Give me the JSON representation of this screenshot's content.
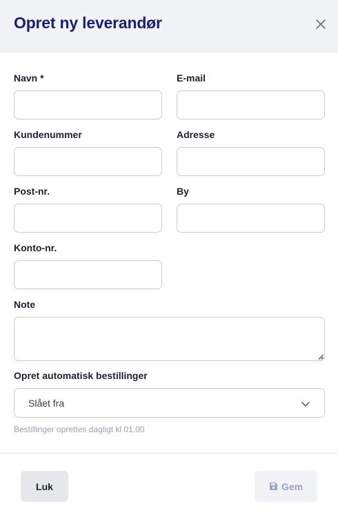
{
  "header": {
    "title": "Opret ny leverandør",
    "close_icon": "close-icon"
  },
  "form": {
    "name": {
      "label": "Navn *",
      "value": "",
      "placeholder": ""
    },
    "email": {
      "label": "E-mail",
      "value": "",
      "placeholder": ""
    },
    "customer_number": {
      "label": "Kundenummer",
      "value": "",
      "placeholder": ""
    },
    "address": {
      "label": "Adresse",
      "value": "",
      "placeholder": ""
    },
    "postal_code": {
      "label": "Post-nr.",
      "value": "",
      "placeholder": ""
    },
    "city": {
      "label": "By",
      "value": "",
      "placeholder": ""
    },
    "account_number": {
      "label": "Konto-nr.",
      "value": "",
      "placeholder": ""
    },
    "note": {
      "label": "Note",
      "value": "",
      "placeholder": ""
    },
    "auto_orders": {
      "label": "Opret automatisk bestillinger",
      "selected": "Slået fra",
      "help": "Bestillinger oprettes dagligt kl 01.00"
    }
  },
  "footer": {
    "close_label": "Luk",
    "save_label": "Gem",
    "save_icon": "floppy-disk-icon"
  },
  "colors": {
    "title": "#1b1f6b",
    "header_bg": "#f1f2f5",
    "border": "#c9ccd3",
    "muted_text": "#9aa0ad",
    "save_disabled_text": "#9aa3c4"
  }
}
